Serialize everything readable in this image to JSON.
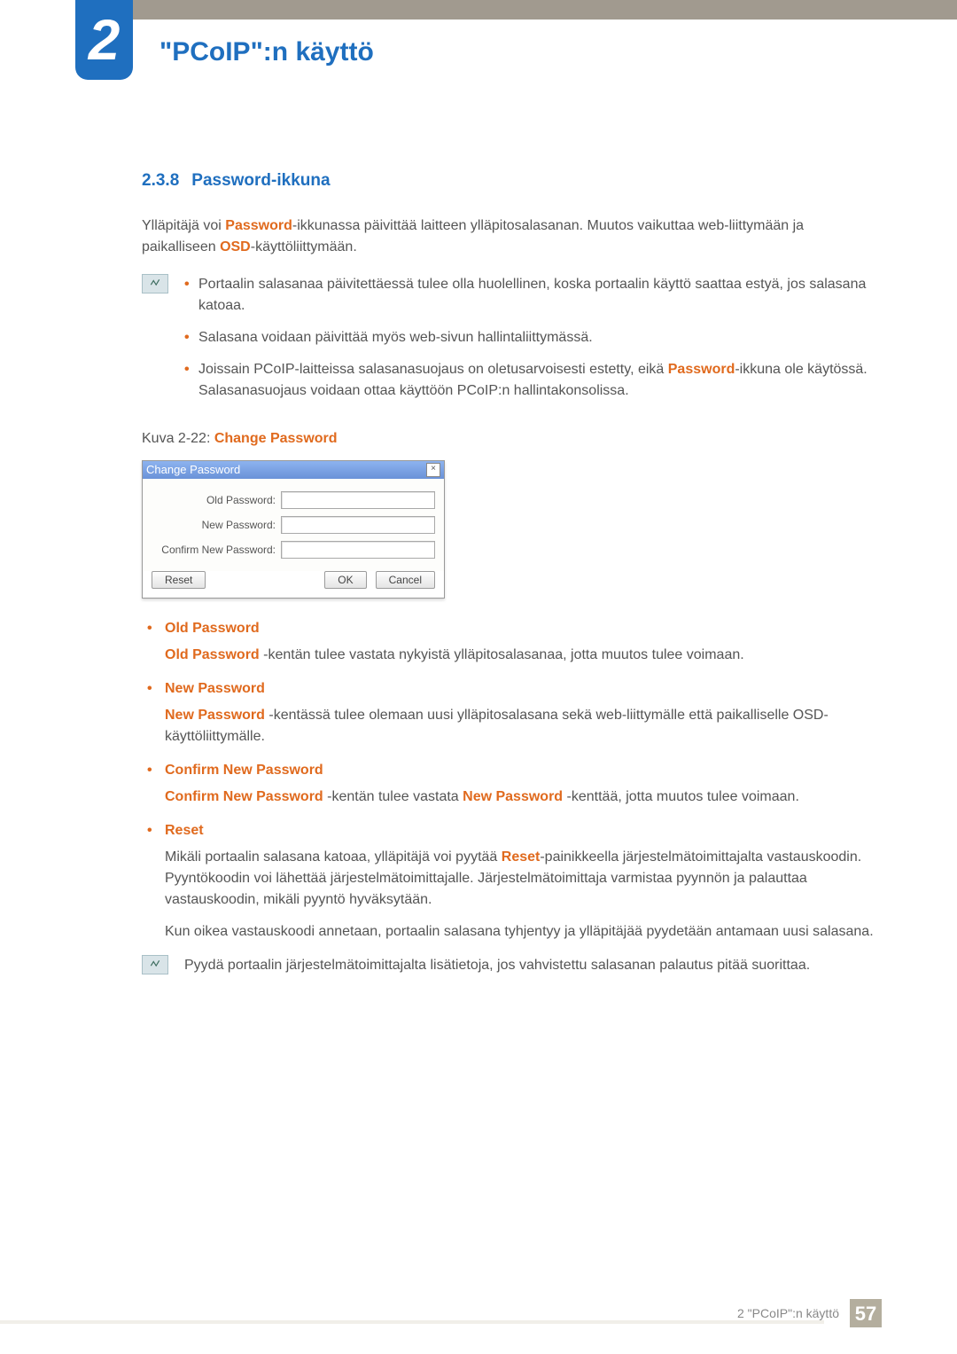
{
  "header": {
    "chapter_number": "2",
    "chapter_title": "\"PCoIP\":n käyttö"
  },
  "section": {
    "number": "2.3.8",
    "title": "Password-ikkuna"
  },
  "intro": {
    "pre1": "Ylläpitäjä voi ",
    "kw1": "Password",
    "post1": "-ikkunassa päivittää laitteen ylläpitosalasanan. Muutos vaikuttaa web-liittymään ja paikalliseen ",
    "kw2": "OSD",
    "post2": "-käyttöliittymään."
  },
  "info": {
    "bullets": [
      "Portaalin salasanaa päivitettäessä tulee olla huolellinen, koska portaalin käyttö saattaa estyä, jos salasana katoaa.",
      "Salasana voidaan päivittää myös web-sivun hallintaliittymässä."
    ],
    "bullet3": {
      "pre": "Joissain PCoIP-laitteissa salasanasuojaus on oletusarvoisesti estetty, eikä ",
      "kw": "Password",
      "post": "-ikkuna ole käytössä. Salasanasuojaus voidaan ottaa käyttöön PCoIP:n hallintakonsolissa."
    }
  },
  "caption": {
    "pre": "Kuva 2-22: ",
    "kw": "Change Password"
  },
  "dialog": {
    "title": "Change Password",
    "close": "×",
    "labels": {
      "old": "Old Password:",
      "new": "New Password:",
      "confirm": "Confirm New Password:"
    },
    "values": {
      "old": "",
      "new": "",
      "confirm": ""
    },
    "buttons": {
      "reset": "Reset",
      "ok": "OK",
      "cancel": "Cancel"
    }
  },
  "defs": {
    "old": {
      "title": "Old Password",
      "b_pre": "Old Password",
      "b_post": " -kentän tulee vastata nykyistä ylläpitosalasanaa, jotta muutos tulee voimaan."
    },
    "new": {
      "title": "New Password",
      "b_pre": "New Password",
      "b_post": " -kentässä tulee olemaan uusi ylläpitosalasana sekä web-liittymälle että paikalliselle OSD-käyttöliittymälle."
    },
    "confirm": {
      "title": "Confirm New Password",
      "b_pre": "Confirm New Password",
      "mid": " -kentän tulee vastata ",
      "kw2": "New Password",
      "b_post": " -kenttää, jotta muutos tulee voimaan."
    },
    "reset": {
      "title": "Reset",
      "p1_pre": "Mikäli portaalin salasana katoaa, ylläpitäjä voi pyytää ",
      "kw": "Reset",
      "p1_post": "-painikkeella järjestelmätoimittajalta vastauskoodin. Pyyntökoodin voi lähettää järjestelmätoimittajalle. Järjestelmätoimittaja varmistaa pyynnön ja palauttaa vastauskoodin, mikäli pyyntö hyväksytään.",
      "p2": "Kun oikea vastauskoodi annetaan, portaalin salasana tyhjentyy ja ylläpitäjää pyydetään antamaan uusi salasana."
    }
  },
  "note": "Pyydä portaalin järjestelmätoimittajalta lisätietoja, jos vahvistettu salasanan palautus pitää suorittaa.",
  "footer": {
    "text": "2 \"PCoIP\":n käyttö",
    "page": "57"
  }
}
